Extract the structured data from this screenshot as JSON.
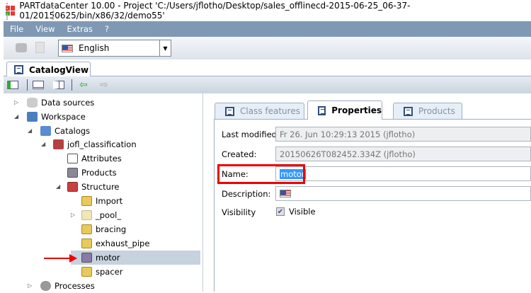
{
  "window": {
    "title": "PARTdataCenter 10.00 - Project 'C:/Users/jflotho/Desktop/sales_offlinecd-2015-06-25_06-37-01/20150625/bin/x86/32/demo55'"
  },
  "menu": [
    "File",
    "View",
    "Extras",
    "?"
  ],
  "toolbar": {
    "language": "English"
  },
  "view_tab": "CatalogView",
  "tree": {
    "data_sources": "Data sources",
    "workspace": "Workspace",
    "catalogs": "Catalogs",
    "catalog": "jofl_classification",
    "attributes": "Attributes",
    "products": "Products",
    "structure": "Structure",
    "import": "Import",
    "pool": "_pool_",
    "bracing": "bracing",
    "exhaust_pipe": "exhaust_pipe",
    "motor": "motor",
    "spacer": "spacer",
    "processes": "Processes"
  },
  "tabs": {
    "class_features": "Class features",
    "properties": "Properties",
    "products": "Products"
  },
  "properties": {
    "last_modified_label": "Last modified:",
    "last_modified": "Fr 26. Jun 10:29:13 2015 (jflotho)",
    "created_label": "Created:",
    "created": "20150626T082452.334Z (jflotho)",
    "name_label": "Name:",
    "name": "motor",
    "description_label": "Description:",
    "visibility_label": "Visibility",
    "visible_label": "Visible",
    "visible": true
  },
  "colors": {
    "menubar": "#7f99b4",
    "highlight": "#e00000",
    "selection": "#3399ff"
  }
}
